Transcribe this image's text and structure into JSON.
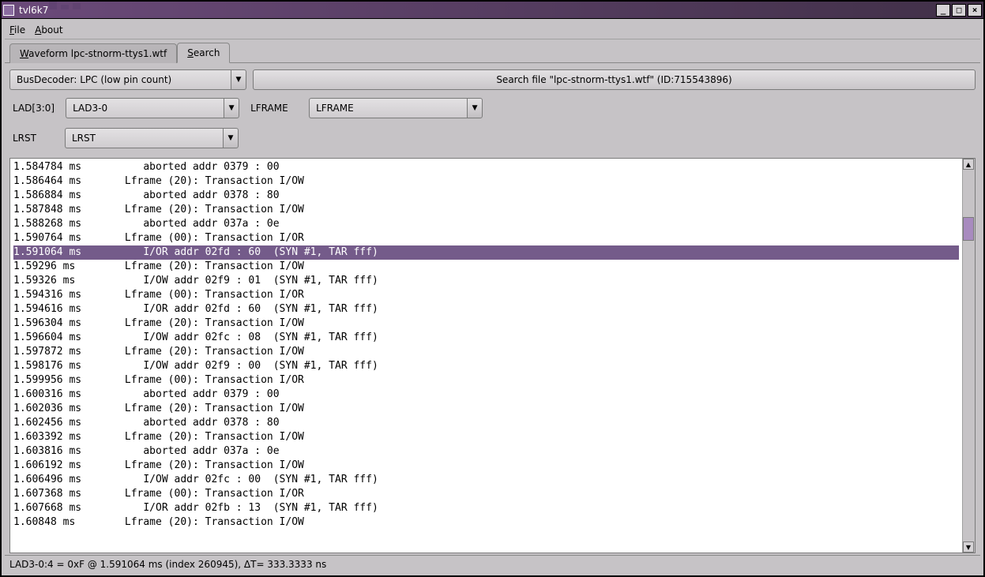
{
  "window": {
    "title": "tvl6k7"
  },
  "menu": {
    "file": "File",
    "about": "About"
  },
  "tabs": {
    "waveform": "Waveform lpc-stnorm-ttys1.wtf",
    "search": "Search"
  },
  "toolbar": {
    "decoder": "BusDecoder: LPC (low pin count)",
    "searchfile": "Search file \"lpc-stnorm-ttys1.wtf\" (ID:715543896)"
  },
  "params": {
    "lad_label": "LAD[3:0]",
    "lad_value": "LAD3-0",
    "lframe_label": "LFRAME",
    "lframe_value": "LFRAME",
    "lrst_label": "LRST",
    "lrst_value": "LRST"
  },
  "rows": [
    {
      "t": "1.584784 ms",
      "b": "   aborted addr 0379 : 00"
    },
    {
      "t": "1.586464 ms",
      "b": "Lframe (20): Transaction I/OW"
    },
    {
      "t": "1.586884 ms",
      "b": "   aborted addr 0378 : 80"
    },
    {
      "t": "1.587848 ms",
      "b": "Lframe (20): Transaction I/OW"
    },
    {
      "t": "1.588268 ms",
      "b": "   aborted addr 037a : 0e"
    },
    {
      "t": "1.590764 ms",
      "b": "Lframe (00): Transaction I/OR"
    },
    {
      "t": "1.591064 ms",
      "b": "   I/OR addr 02fd : 60  (SYN #1, TAR fff)",
      "sel": true
    },
    {
      "t": "1.59296 ms",
      "b": "Lframe (20): Transaction I/OW"
    },
    {
      "t": "1.59326 ms",
      "b": "   I/OW addr 02f9 : 01  (SYN #1, TAR fff)"
    },
    {
      "t": "1.594316 ms",
      "b": "Lframe (00): Transaction I/OR"
    },
    {
      "t": "1.594616 ms",
      "b": "   I/OR addr 02fd : 60  (SYN #1, TAR fff)"
    },
    {
      "t": "1.596304 ms",
      "b": "Lframe (20): Transaction I/OW"
    },
    {
      "t": "1.596604 ms",
      "b": "   I/OW addr 02fc : 08  (SYN #1, TAR fff)"
    },
    {
      "t": "1.597872 ms",
      "b": "Lframe (20): Transaction I/OW"
    },
    {
      "t": "1.598176 ms",
      "b": "   I/OW addr 02f9 : 00  (SYN #1, TAR fff)"
    },
    {
      "t": "1.599956 ms",
      "b": "Lframe (00): Transaction I/OR"
    },
    {
      "t": "1.600316 ms",
      "b": "   aborted addr 0379 : 00"
    },
    {
      "t": "1.602036 ms",
      "b": "Lframe (20): Transaction I/OW"
    },
    {
      "t": "1.602456 ms",
      "b": "   aborted addr 0378 : 80"
    },
    {
      "t": "1.603392 ms",
      "b": "Lframe (20): Transaction I/OW"
    },
    {
      "t": "1.603816 ms",
      "b": "   aborted addr 037a : 0e"
    },
    {
      "t": "1.606192 ms",
      "b": "Lframe (20): Transaction I/OW"
    },
    {
      "t": "1.606496 ms",
      "b": "   I/OW addr 02fc : 00  (SYN #1, TAR fff)"
    },
    {
      "t": "1.607368 ms",
      "b": "Lframe (00): Transaction I/OR"
    },
    {
      "t": "1.607668 ms",
      "b": "   I/OR addr 02fb : 13  (SYN #1, TAR fff)"
    },
    {
      "t": "1.60848 ms",
      "b": "Lframe (20): Transaction I/OW"
    }
  ],
  "status": "LAD3-0:4 = 0xF @ 1.591064 ms  (index 260945), ΔT= 333.3333 ns"
}
